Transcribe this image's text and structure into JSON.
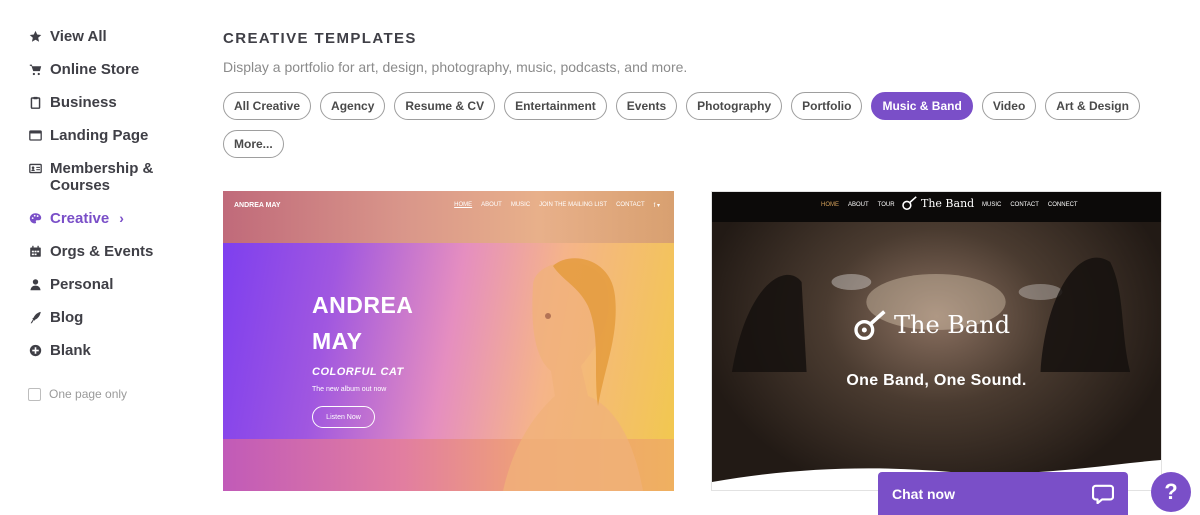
{
  "sidebar": {
    "items": [
      {
        "label": "View All",
        "icon": "star-icon"
      },
      {
        "label": "Online Store",
        "icon": "cart-icon"
      },
      {
        "label": "Business",
        "icon": "clipboard-icon"
      },
      {
        "label": "Landing Page",
        "icon": "browser-window-icon"
      },
      {
        "label": "Membership & Courses",
        "icon": "id-card-icon"
      },
      {
        "label": "Creative",
        "icon": "palette-icon",
        "active": true
      },
      {
        "label": "Orgs & Events",
        "icon": "calendar-icon"
      },
      {
        "label": "Personal",
        "icon": "person-icon"
      },
      {
        "label": "Blog",
        "icon": "quill-icon"
      },
      {
        "label": "Blank",
        "icon": "plus-circle-icon"
      }
    ],
    "one_page_only": {
      "label": "One page only",
      "checked": false
    }
  },
  "main": {
    "title": "CREATIVE TEMPLATES",
    "subtitle": "Display a portfolio for art, design, photography, music, podcasts, and more.",
    "chips": [
      {
        "label": "All Creative",
        "active": false
      },
      {
        "label": "Agency",
        "active": false
      },
      {
        "label": "Resume & CV",
        "active": false
      },
      {
        "label": "Entertainment",
        "active": false
      },
      {
        "label": "Events",
        "active": false
      },
      {
        "label": "Photography",
        "active": false
      },
      {
        "label": "Portfolio",
        "active": false
      },
      {
        "label": "Music & Band",
        "active": true
      },
      {
        "label": "Video",
        "active": false
      },
      {
        "label": "Art & Design",
        "active": false
      },
      {
        "label": "More...",
        "active": false
      }
    ]
  },
  "templates": {
    "andrea": {
      "logo": "ANDREA MAY",
      "nav": [
        "HOME",
        "ABOUT",
        "MUSIC",
        "JOIN THE MAILING LIST",
        "CONTACT",
        "f ▾"
      ],
      "title_line1": "ANDREA",
      "title_line2": "MAY",
      "album": "COLORFUL CAT",
      "subtitle": "The new album out now",
      "button": "Listen Now"
    },
    "band": {
      "nav_left": [
        "HOME",
        "ABOUT",
        "TOUR"
      ],
      "nav_brand": "The Band",
      "nav_right": [
        "MUSIC",
        "CONTACT",
        "CONNECT"
      ],
      "brand": "The Band",
      "tagline": "One Band, One Sound."
    }
  },
  "chat": {
    "label": "Chat now",
    "icon": "chat-bubble-icon"
  },
  "help": {
    "label": "?",
    "icon": "help-icon"
  },
  "colors": {
    "accent": "#7a4fc8",
    "text": "#3f3f46",
    "muted": "#8b8b8b"
  }
}
